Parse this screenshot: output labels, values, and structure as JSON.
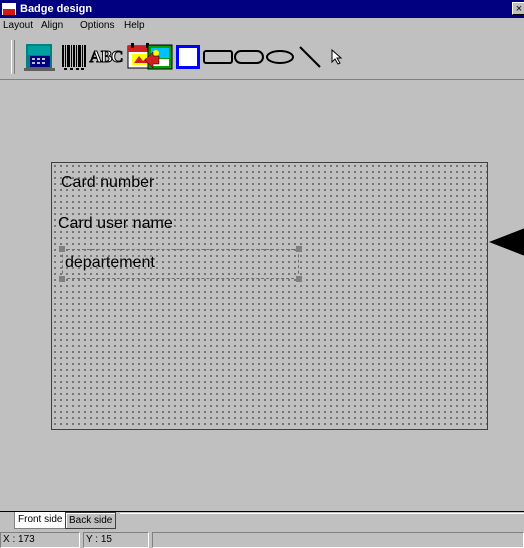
{
  "window": {
    "title": "Badge design",
    "close_label": "×"
  },
  "menubar": {
    "items": [
      "Layout",
      "Align",
      "Options",
      "Help"
    ]
  },
  "toolbar": {
    "tools": [
      "card-reader-tool",
      "barcode-tool",
      "text-tool",
      "calendar-image-tool",
      "photo-tool",
      "rectangle-tool",
      "rounded-rectangle-tool",
      "ellipse-tool",
      "line-tool",
      "pointer-tool"
    ],
    "selected_tool": "rectangle-tool",
    "text_tool_label": "ABC"
  },
  "card": {
    "fields": [
      "Card number",
      "Card user name",
      "departement"
    ],
    "selected_field": "departement"
  },
  "tabs": [
    {
      "label": "Front side",
      "active": true
    },
    {
      "label": "Back side",
      "active": false
    }
  ],
  "status": {
    "x": "X : 173",
    "y": "Y : 15"
  },
  "colors": {
    "titlebar": "#000080",
    "face": "#c0c0c0",
    "selected_tool_border": "#0000ff"
  }
}
